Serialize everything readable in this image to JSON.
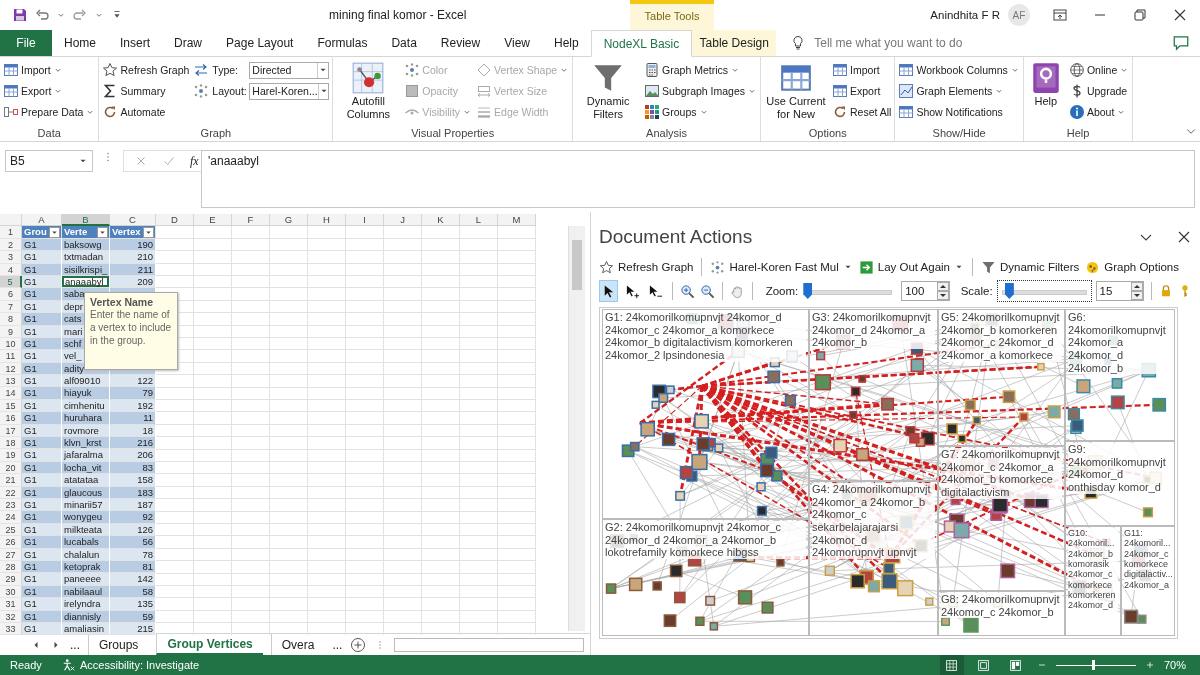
{
  "title_bar": {
    "title": "mining final komor  -  Excel",
    "context_label": "Table Tools",
    "user_name": "Anindhita F R",
    "user_initials": "AF"
  },
  "tabs": [
    {
      "label": "File",
      "selected": false
    },
    {
      "label": "Home",
      "selected": false
    },
    {
      "label": "Insert",
      "selected": false
    },
    {
      "label": "Draw",
      "selected": false
    },
    {
      "label": "Page Layout",
      "selected": false
    },
    {
      "label": "Formulas",
      "selected": false
    },
    {
      "label": "Data",
      "selected": false
    },
    {
      "label": "Review",
      "selected": false
    },
    {
      "label": "View",
      "selected": false
    },
    {
      "label": "Help",
      "selected": false
    },
    {
      "label": "NodeXL Basic",
      "selected": true
    },
    {
      "label": "Table Design",
      "selected": false
    }
  ],
  "tell_me": {
    "placeholder": "Tell me what you want to do"
  },
  "ribbon": {
    "groups": [
      {
        "label": "Data",
        "columns": [
          [
            {
              "kind": "small",
              "label": "Import",
              "dropdown": true
            },
            {
              "kind": "small",
              "label": "Export",
              "dropdown": true
            },
            {
              "kind": "small",
              "label": "Prepare Data",
              "dropdown": true
            }
          ]
        ]
      },
      {
        "label": "Graph",
        "columns": [
          [
            {
              "kind": "small",
              "label": "Refresh Graph",
              "dropdown": false
            },
            {
              "kind": "small",
              "label": "Summary",
              "dropdown": false
            },
            {
              "kind": "small",
              "label": "Automate",
              "dropdown": false
            }
          ],
          [
            {
              "kind": "combo",
              "label": "Type:",
              "value": "Directed"
            },
            {
              "kind": "combo",
              "label": "Layout:",
              "value": "Harel-Koren..."
            }
          ]
        ]
      },
      {
        "label": "Visual Properties",
        "columns": [
          [
            {
              "kind": "large",
              "label": "Autofill Columns",
              "disabled": false
            }
          ],
          [
            {
              "kind": "small",
              "label": "Color",
              "dropdown": false,
              "disabled": true
            },
            {
              "kind": "small",
              "label": "Opacity",
              "dropdown": false,
              "disabled": true
            },
            {
              "kind": "small",
              "label": "Visibility",
              "dropdown": true,
              "disabled": true
            }
          ],
          [
            {
              "kind": "small",
              "label": "Vertex Shape",
              "dropdown": true,
              "disabled": true
            },
            {
              "kind": "small",
              "label": "Vertex Size",
              "dropdown": false,
              "disabled": true
            },
            {
              "kind": "small",
              "label": "Edge Width",
              "dropdown": false,
              "disabled": true
            }
          ]
        ]
      },
      {
        "label": "Analysis",
        "columns": [
          [
            {
              "kind": "large",
              "label": "Dynamic Filters"
            }
          ],
          [
            {
              "kind": "small",
              "label": "Graph Metrics",
              "dropdown": true
            },
            {
              "kind": "small",
              "label": "Subgraph Images",
              "dropdown": true
            },
            {
              "kind": "small",
              "label": "Groups",
              "dropdown": true
            }
          ]
        ]
      },
      {
        "label": "Options",
        "columns": [
          [
            {
              "kind": "large",
              "label": "Use Current for New"
            }
          ],
          [
            {
              "kind": "small",
              "label": "Import",
              "dropdown": false
            },
            {
              "kind": "small",
              "label": "Export",
              "dropdown": false
            },
            {
              "kind": "small",
              "label": "Reset All",
              "dropdown": false
            }
          ]
        ]
      },
      {
        "label": "Show/Hide",
        "columns": [
          [
            {
              "kind": "small",
              "label": "Workbook Columns",
              "dropdown": true
            },
            {
              "kind": "small",
              "label": "Graph Elements",
              "dropdown": true
            },
            {
              "kind": "small",
              "label": "Show Notifications",
              "dropdown": false
            }
          ]
        ]
      },
      {
        "label": "Help",
        "columns": [
          [
            {
              "kind": "large",
              "label": "Help"
            }
          ],
          [
            {
              "kind": "small",
              "label": "Online",
              "dropdown": true
            },
            {
              "kind": "small",
              "label": "Upgrade",
              "dropdown": false
            },
            {
              "kind": "small",
              "label": "About",
              "dropdown": true
            }
          ]
        ]
      }
    ]
  },
  "formula_bar": {
    "name_box": "B5",
    "function_label": "fx",
    "formula": "'anaaabyl"
  },
  "sheet": {
    "columns": [
      {
        "label": "A",
        "selected": false
      },
      {
        "label": "B",
        "selected": true
      },
      {
        "label": "C",
        "selected": false
      },
      {
        "label": "D",
        "selected": false
      },
      {
        "label": "E",
        "selected": false
      },
      {
        "label": "F",
        "selected": false
      },
      {
        "label": "G",
        "selected": false
      },
      {
        "label": "H",
        "selected": false
      },
      {
        "label": "I",
        "selected": false
      },
      {
        "label": "J",
        "selected": false
      },
      {
        "label": "K",
        "selected": false
      },
      {
        "label": "L",
        "selected": false
      },
      {
        "label": "M",
        "selected": false
      }
    ],
    "rows": [
      {
        "number": "1",
        "kind": "header",
        "selected": false,
        "cells": [
          "Grou",
          "Verte",
          "Vertex"
        ]
      },
      {
        "number": "2",
        "kind": "data",
        "selected": false,
        "cells": [
          "G1",
          "baksowg",
          "190"
        ]
      },
      {
        "number": "3",
        "kind": "data",
        "selected": false,
        "cells": [
          "G1",
          "txtmadan",
          "210"
        ]
      },
      {
        "number": "4",
        "kind": "data",
        "selected": false,
        "cells": [
          "G1",
          "sisilkrispi_",
          "211"
        ]
      },
      {
        "number": "5",
        "kind": "data",
        "selected": true,
        "cells": [
          "G1",
          "anaaabyl",
          "209"
        ]
      },
      {
        "number": "6",
        "kind": "data",
        "selected": false,
        "cells": [
          "G1",
          "saba"
        ]
      },
      {
        "number": "7",
        "kind": "data",
        "selected": false,
        "cells": [
          "G1",
          "depr"
        ]
      },
      {
        "number": "8",
        "kind": "data",
        "selected": false,
        "cells": [
          "G1",
          "cats"
        ]
      },
      {
        "number": "9",
        "kind": "data",
        "selected": false,
        "cells": [
          "G1",
          "mari"
        ]
      },
      {
        "number": "10",
        "kind": "data",
        "selected": false,
        "cells": [
          "G1",
          "schf"
        ]
      },
      {
        "number": "11",
        "kind": "data",
        "selected": false,
        "cells": [
          "G1",
          "vel_"
        ]
      },
      {
        "number": "12",
        "kind": "data",
        "selected": false,
        "cells": [
          "G1",
          "adity"
        ]
      },
      {
        "number": "13",
        "kind": "data",
        "selected": false,
        "cells": [
          "G1",
          "alf09010",
          "122"
        ]
      },
      {
        "number": "14",
        "kind": "data",
        "selected": false,
        "cells": [
          "G1",
          "hiayuk",
          "79"
        ]
      },
      {
        "number": "15",
        "kind": "data",
        "selected": false,
        "cells": [
          "G1",
          "cimhenitu",
          "192"
        ]
      },
      {
        "number": "16",
        "kind": "data",
        "selected": false,
        "cells": [
          "G1",
          "huruhara",
          "11"
        ]
      },
      {
        "number": "17",
        "kind": "data",
        "selected": false,
        "cells": [
          "G1",
          "rovmore",
          "18"
        ]
      },
      {
        "number": "18",
        "kind": "data",
        "selected": false,
        "cells": [
          "G1",
          "klvn_krst",
          "216"
        ]
      },
      {
        "number": "19",
        "kind": "data",
        "selected": false,
        "cells": [
          "G1",
          "jafaralma",
          "206"
        ]
      },
      {
        "number": "20",
        "kind": "data",
        "selected": false,
        "cells": [
          "G1",
          "locha_vit",
          "83"
        ]
      },
      {
        "number": "21",
        "kind": "data",
        "selected": false,
        "cells": [
          "G1",
          "atatataa",
          "158"
        ]
      },
      {
        "number": "22",
        "kind": "data",
        "selected": false,
        "cells": [
          "G1",
          "glaucous",
          "183"
        ]
      },
      {
        "number": "23",
        "kind": "data",
        "selected": false,
        "cells": [
          "G1",
          "minarii57",
          "187"
        ]
      },
      {
        "number": "24",
        "kind": "data",
        "selected": false,
        "cells": [
          "G1",
          "wonygeu",
          "92"
        ]
      },
      {
        "number": "25",
        "kind": "data",
        "selected": false,
        "cells": [
          "G1",
          "milkteata",
          "126"
        ]
      },
      {
        "number": "26",
        "kind": "data",
        "selected": false,
        "cells": [
          "G1",
          "lucabals",
          "56"
        ]
      },
      {
        "number": "27",
        "kind": "data",
        "selected": false,
        "cells": [
          "G1",
          "chalalun",
          "78"
        ]
      },
      {
        "number": "28",
        "kind": "data",
        "selected": false,
        "cells": [
          "G1",
          "ketoprak",
          "81"
        ]
      },
      {
        "number": "29",
        "kind": "data",
        "selected": false,
        "cells": [
          "G1",
          "paneeee",
          "142"
        ]
      },
      {
        "number": "30",
        "kind": "data",
        "selected": false,
        "cells": [
          "G1",
          "nabilaaul",
          "58"
        ]
      },
      {
        "number": "31",
        "kind": "data",
        "selected": false,
        "cells": [
          "G1",
          "irelyndra",
          "135"
        ]
      },
      {
        "number": "32",
        "kind": "data",
        "selected": false,
        "cells": [
          "G1",
          "diannisly",
          "59"
        ]
      },
      {
        "number": "33",
        "kind": "data",
        "selected": false,
        "cells": [
          "G1",
          "amaliasin",
          "215"
        ]
      }
    ]
  },
  "tooltip": {
    "title": "Vertex Name",
    "text": "Enter the name of a vertex to include in the group."
  },
  "sheet_tabs": {
    "more_left": "...",
    "items": [
      {
        "label": "Groups",
        "selected": false
      },
      {
        "label": "Group Vertices",
        "selected": true
      },
      {
        "label": "Overa",
        "selected": false
      }
    ],
    "more_right": "..."
  },
  "document_actions": {
    "title": "Document Actions",
    "toolbar": [
      {
        "kind": "button",
        "label": "Refresh Graph"
      },
      {
        "kind": "menu",
        "label": "Harel-Koren Fast Mul"
      },
      {
        "kind": "menu",
        "label": "Lay Out Again"
      },
      {
        "kind": "button",
        "label": "Dynamic Filters"
      },
      {
        "kind": "button",
        "label": "Graph Options"
      }
    ],
    "pointer_tools": [
      {
        "selected": true
      },
      {
        "selected": false
      },
      {
        "selected": false
      }
    ],
    "zoom": {
      "label": "Zoom:",
      "level": 0.0,
      "value": "100"
    },
    "scale": {
      "label": "Scale:",
      "level": 0.08,
      "value": "15"
    },
    "groups": [
      {
        "label": "G1: 24komorilkomupnvjt 24komor_d 24komor_c 24komor_a komorkece 24komor_b digitalactivism komorkeren 24komor_2 lpsindonesia"
      },
      {
        "label": "G2: 24komorilkomupnvjt 24komor_c 24komor_d 24komor_a 24komor_b lokotrefamily komorkece hibgss"
      },
      {
        "label": "G3: 24komorilkomupnvjt 24komor_d 24komor_a 24komor_b"
      },
      {
        "label": "G4: 24komorilkomupnvjt 24komor_a 24komor_b 24komor_c sekarbelajarajarsi 24komor_d 24komorupnvjt upnvjt"
      },
      {
        "label": "G5: 24komorilkomupnvjt 24komor_b komorkeren 24komor_c 24komor_d 24komor_a komorkece"
      },
      {
        "label": "G7: 24komorilkomupnvjt 24komor_c 24komor_a 24komor_b komorkece digitalactivism"
      },
      {
        "label": "G8: 24komorilkomupnvjt 24komor_c 24komor_b"
      },
      {
        "label": "G6: 24komorilkomupnvjt 24komor_a 24komor_d 24komor_b"
      },
      {
        "label": "G9: 24komorilkomupnvjt 24komor_d onthisday komor_d"
      },
      {
        "label": "G10: 24komoril... 24komor_b komorasik 24komor_c komorkece komorkeren 24komor_d"
      },
      {
        "label": "G11: 24komoril... 24komor_c komorkece digitalactiv... 24komor_a"
      }
    ]
  },
  "status_bar": {
    "state": "Ready",
    "accessibility": "Accessibility: Investigate",
    "views": [
      {
        "selected": true
      },
      {
        "selected": false
      },
      {
        "selected": false
      }
    ],
    "zoom_slider": {
      "level": 0.47
    },
    "zoom": "70%"
  }
}
